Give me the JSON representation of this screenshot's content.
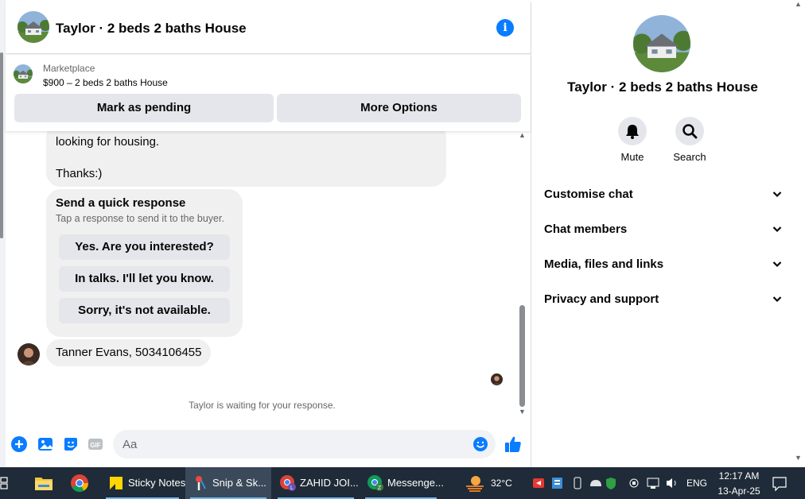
{
  "header": {
    "title": "Taylor · 2 beds 2 baths House"
  },
  "marketplace": {
    "label": "Marketplace",
    "listing": "$900 – 2 beds 2 baths House",
    "buttons": [
      "Mark as pending",
      "More Options"
    ]
  },
  "messages": {
    "partial_lines": [
      "looking for housing.",
      "Thanks:)"
    ],
    "quick_response": {
      "title": "Send a quick response",
      "subtitle": "Tap a response to send it to the buyer.",
      "options": [
        "Yes. Are you interested?",
        "In talks. I'll let you know.",
        "Sorry, it's not available."
      ]
    },
    "contact_message": "Tanner Evans, 5034106455",
    "status": "Taylor is waiting for your response."
  },
  "composer": {
    "placeholder": "Aa"
  },
  "panel": {
    "title": "Taylor · 2 beds 2 baths House",
    "actions": [
      "Mute",
      "Search"
    ],
    "sections": [
      "Customise chat",
      "Chat members",
      "Media, files and links",
      "Privacy and support"
    ]
  },
  "taskbar": {
    "apps": [
      "Sticky Notes",
      "Snip & Sk...",
      "ZAHID JOI...",
      "Messenge..."
    ],
    "weather": "32°C",
    "language": "ENG",
    "time": "12:17 AM",
    "date": "13-Apr-25"
  },
  "colors": {
    "accent": "#0a7cff",
    "bubble": "#f0f0f0",
    "button": "#e4e6eb",
    "taskbar": "#1f2b38"
  }
}
